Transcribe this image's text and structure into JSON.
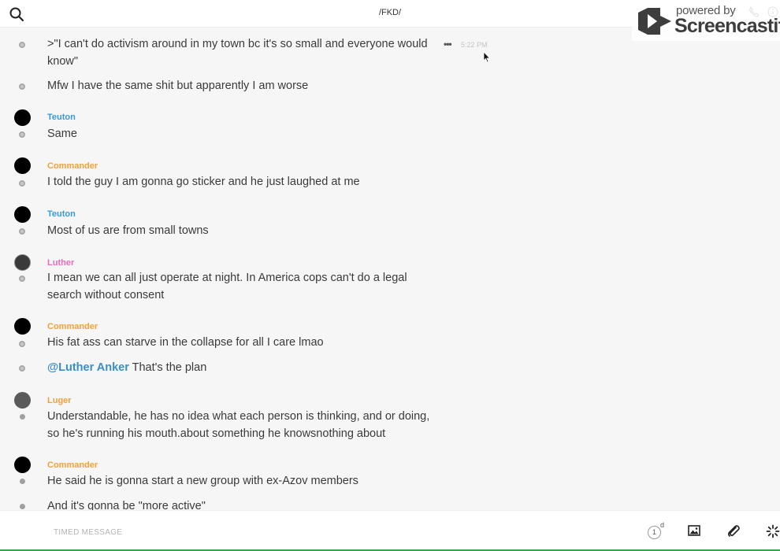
{
  "header": {
    "channel_title": "/FKD/",
    "search_icon": "search-icon",
    "call_icon": "phone-icon",
    "info_icon": "info-icon"
  },
  "watermark": {
    "powered_by": "powered by",
    "brand": "Screencastify"
  },
  "messages": [
    {
      "author": "",
      "text": ">\"I can't do activism around in my town bc it's so small and everyone would know\"",
      "timestamp": "5:22 PM",
      "more": "•••"
    },
    {
      "author": "",
      "text": "Mfw I have the same shit but apparently I am worse"
    },
    {
      "author": "Teuton",
      "text": "Same"
    },
    {
      "author": "Commander",
      "text": "I told the guy I am gonna go sticker and he just laughed at me"
    },
    {
      "author": "Teuton",
      "text": "Most of us are from small towns"
    },
    {
      "author": "Luther",
      "text": "I mean we can all just operate at night. In America cops can't do a legal search without consent"
    },
    {
      "author": "Commander",
      "text": "His fat ass can starve in the collapse for all I care lmao"
    },
    {
      "author": "",
      "mention": "@Luther Anker",
      "text": " That's the plan"
    },
    {
      "author": "Luger",
      "text": "Understandable, he has no idea what each person is thinking, and or doing, so he's running his mouth.about something he knowsnothing about"
    },
    {
      "author": "Commander",
      "text": "He said he is gonna start a new group with ex-Azov members"
    },
    {
      "author": "",
      "text": "And it's gonna be \"more active\""
    }
  ],
  "colors": {
    "teuton": "#3a9ad9",
    "commander": "#f0a13c",
    "luther": "#e46fb8",
    "luger": "#f0a13c",
    "mention": "#3a8fc7"
  },
  "composer": {
    "placeholder": "TIMED MESSAGE",
    "timer_value": "1",
    "timer_unit": "d",
    "image_icon": "image-icon",
    "attach_icon": "paperclip-icon",
    "more_icon": "sparkle-icon"
  }
}
